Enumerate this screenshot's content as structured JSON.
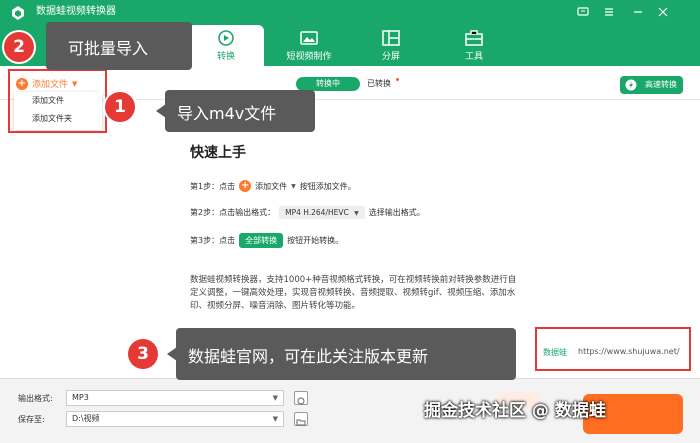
{
  "window": {
    "title": "数据蛙视频转换器"
  },
  "nav": {
    "tabs": [
      {
        "label": "转换",
        "icon": "refresh-play-icon",
        "active": true
      },
      {
        "label": "短视频制作",
        "icon": "image-icon",
        "active": false
      },
      {
        "label": "分屏",
        "icon": "split-screen-icon",
        "active": false
      },
      {
        "label": "工具",
        "icon": "toolbox-icon",
        "active": false
      }
    ]
  },
  "toolbar": {
    "add_file_label": "添加文件",
    "converting_label": "转换中",
    "converted_label": "已转换",
    "fast_convert_label": "高速转换"
  },
  "dropdown": {
    "items": [
      "添加文件",
      "添加文件夹"
    ]
  },
  "guide": {
    "title": "快速上手",
    "step1_prefix": "第1步：点击",
    "step1_btn": "添加文件",
    "step1_suffix": "按钮添加文件。",
    "step2_prefix": "第2步：点击输出格式：",
    "step2_fmt": "MP4 H.264/HEVC",
    "step2_suffix": "选择输出格式。",
    "step3_prefix": "第3步：点击",
    "step3_btn": "全部转换",
    "step3_suffix": "按钮开始转换。",
    "description": "数据蛙视频转换器，支持1000+种音视频格式转换，可在视频转换前对转换参数进行自定义调整，一键高效处理，实现音视频转换、音频提取、视频转gif、视频压缩、添加水印、视频分屏、噪音消除、图片转化等功能。"
  },
  "site": {
    "brand": "数据蛙",
    "url": "https://www.shujuwa.net/"
  },
  "bottom": {
    "output_format_label": "输出格式:",
    "output_format_value": "MP3",
    "save_to_label": "保存至:",
    "save_to_value": "D:\\视频"
  },
  "annotations": {
    "a1_num": "1",
    "a1_text": "导入m4v文件",
    "a2_num": "2",
    "a2_text": "可批量导入",
    "a3_num": "3",
    "a3_text": "数据蛙官网，可在此关注版本更新",
    "watermark": "掘金技术社区 @ 数据蛙"
  },
  "colors": {
    "brand_green": "#1aa86a",
    "accent_orange": "#ff7a2e",
    "annotation_red": "#e53935",
    "callout_gray": "#5a5a5a"
  }
}
